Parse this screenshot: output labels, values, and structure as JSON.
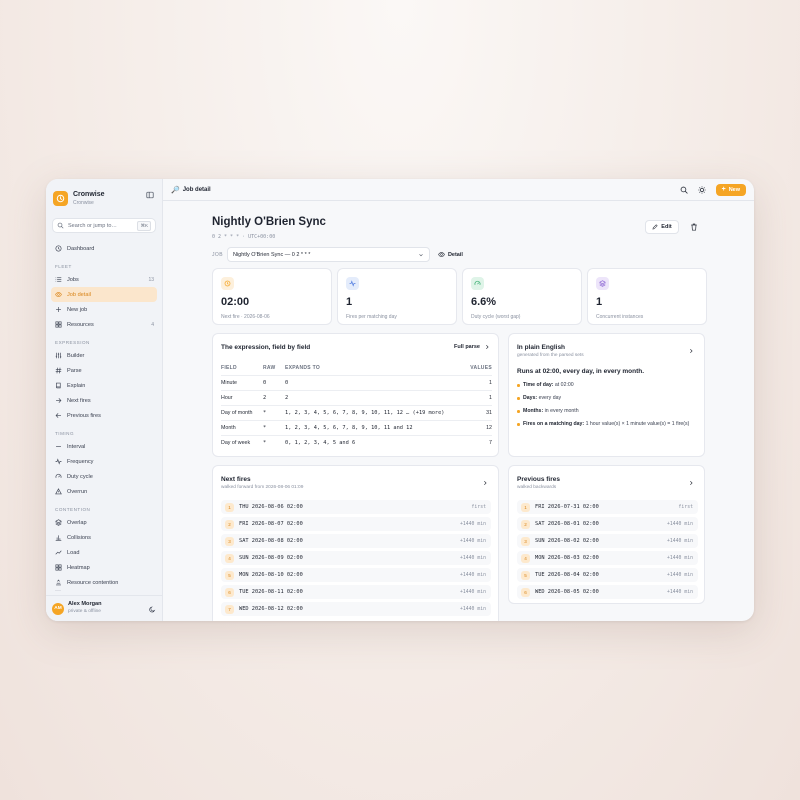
{
  "app": {
    "name": "Cronwise",
    "workspace": "Cronwise"
  },
  "search": {
    "placeholder": "Search or jump to…",
    "shortcut": "⌘K"
  },
  "sidebar": {
    "dashboard": "Dashboard",
    "sections": [
      {
        "label": "FLEET",
        "items": [
          {
            "label": "Jobs",
            "icon": "list-icon",
            "count": "13"
          },
          {
            "label": "Job detail",
            "icon": "eye-icon",
            "active": true
          },
          {
            "label": "New job",
            "icon": "plus-icon"
          },
          {
            "label": "Resources",
            "icon": "grid-icon",
            "count": "4"
          }
        ]
      },
      {
        "label": "EXPRESSION",
        "items": [
          {
            "label": "Builder",
            "icon": "sliders-icon"
          },
          {
            "label": "Parse",
            "icon": "hash-icon"
          },
          {
            "label": "Explain",
            "icon": "book-icon"
          },
          {
            "label": "Next fires",
            "icon": "arrow-right-icon"
          },
          {
            "label": "Previous fires",
            "icon": "arrow-left-icon"
          }
        ]
      },
      {
        "label": "TIMING",
        "items": [
          {
            "label": "Interval",
            "icon": "minus-icon"
          },
          {
            "label": "Frequency",
            "icon": "pulse-icon"
          },
          {
            "label": "Duty cycle",
            "icon": "gauge-icon"
          },
          {
            "label": "Overrun",
            "icon": "alert-icon"
          }
        ]
      },
      {
        "label": "CONTENTION",
        "items": [
          {
            "label": "Overlap",
            "icon": "layers-icon"
          },
          {
            "label": "Collisions",
            "icon": "bar-chart-icon"
          },
          {
            "label": "Load",
            "icon": "trend-icon"
          },
          {
            "label": "Heatmap",
            "icon": "grid-icon"
          },
          {
            "label": "Resource contention",
            "icon": "stack-icon"
          }
        ]
      }
    ],
    "more": "···"
  },
  "user": {
    "initials": "AM",
    "name": "Alex Morgan",
    "status": "private & offline"
  },
  "topbar": {
    "crumb_icon": "🔎",
    "crumb": "Job detail",
    "new_label": "New"
  },
  "job": {
    "title": "Nightly O'Brien Sync",
    "subtitle": "0 2 * * * · UTC+00:00",
    "edit_label": "Edit",
    "selector_label": "JOB",
    "selected": "Nightly O'Brien Sync — 0 2 * * *",
    "detail_label": "Detail"
  },
  "stats": [
    {
      "value": "02:00",
      "label": "Next fire · 2026-08-06",
      "color": "#f5a524",
      "bg": "#fdf0dc"
    },
    {
      "value": "1",
      "label": "Fires per matching day",
      "color": "#4f7be0",
      "bg": "#e4ecfb"
    },
    {
      "value": "6.6%",
      "label": "Duty cycle (worst gap)",
      "color": "#2faa6a",
      "bg": "#dff4e8"
    },
    {
      "value": "1",
      "label": "Concurrent instances",
      "color": "#8a63d2",
      "bg": "#ede5fa"
    }
  ],
  "expression": {
    "title": "The expression, field by field",
    "full_parse": "Full parse",
    "headers": [
      "FIELD",
      "RAW",
      "EXPANDS TO",
      "VALUES"
    ],
    "rows": [
      [
        "Minute",
        "0",
        "0",
        "1"
      ],
      [
        "Hour",
        "2",
        "2",
        "1"
      ],
      [
        "Day of month",
        "*",
        "1, 2, 3, 4, 5, 6, 7, 8, 9, 10, 11, 12 … (+19 more)",
        "31"
      ],
      [
        "Month",
        "*",
        "1, 2, 3, 4, 5, 6, 7, 8, 9, 10, 11 and 12",
        "12"
      ],
      [
        "Day of week",
        "*",
        "0, 1, 2, 3, 4, 5 and 6",
        "7"
      ]
    ]
  },
  "plain": {
    "title": "In plain English",
    "sub": "generated from the parsed sets",
    "headline": "Runs at 02:00, every day, in every month.",
    "items": [
      {
        "k": "Time of day:",
        "v": " at 02:00"
      },
      {
        "k": "Days:",
        "v": " every day"
      },
      {
        "k": "Months:",
        "v": " in every month"
      },
      {
        "k": "Fires on a matching day:",
        "v": " 1 hour value(s) × 1 minute value(s) = 1 fire(s)"
      }
    ]
  },
  "next": {
    "title": "Next fires",
    "sub": "walked forward from 2026-08-06 01:09",
    "rows": [
      {
        "n": "1",
        "t": "THU 2026-08-06 02:00",
        "d": "first"
      },
      {
        "n": "2",
        "t": "FRI 2026-08-07 02:00",
        "d": "+1440 min"
      },
      {
        "n": "3",
        "t": "SAT 2026-08-08 02:00",
        "d": "+1440 min"
      },
      {
        "n": "4",
        "t": "SUN 2026-08-09 02:00",
        "d": "+1440 min"
      },
      {
        "n": "5",
        "t": "MON 2026-08-10 02:00",
        "d": "+1440 min"
      },
      {
        "n": "6",
        "t": "TUE 2026-08-11 02:00",
        "d": "+1440 min"
      },
      {
        "n": "7",
        "t": "WED 2026-08-12 02:00",
        "d": "+1440 min"
      }
    ]
  },
  "prev": {
    "title": "Previous fires",
    "sub": "walked backwards",
    "rows": [
      {
        "n": "1",
        "t": "FRI 2026-07-31 02:00",
        "d": "first"
      },
      {
        "n": "2",
        "t": "SAT 2026-08-01 02:00",
        "d": "+1440 min"
      },
      {
        "n": "3",
        "t": "SUN 2026-08-02 02:00",
        "d": "+1440 min"
      },
      {
        "n": "4",
        "t": "MON 2026-08-03 02:00",
        "d": "+1440 min"
      },
      {
        "n": "5",
        "t": "TUE 2026-08-04 02:00",
        "d": "+1440 min"
      },
      {
        "n": "6",
        "t": "WED 2026-08-05 02:00",
        "d": "+1440 min"
      }
    ]
  }
}
